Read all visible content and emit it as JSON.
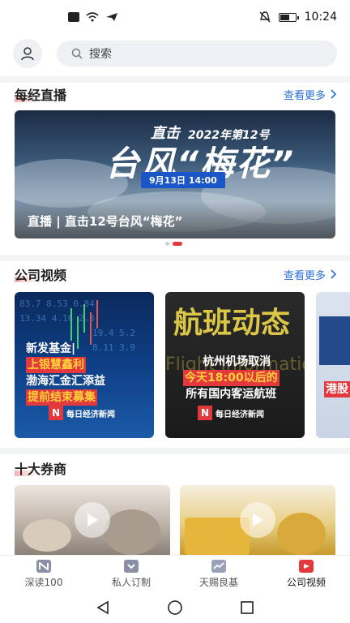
{
  "status_bar": {
    "time": "10:24",
    "battery_level": 0.55
  },
  "search": {
    "placeholder": "搜索"
  },
  "live_section": {
    "title": "每经直播",
    "more_label": "查看更多",
    "banner": {
      "headline_a": "直击",
      "headline_b": "台风“梅花”",
      "sub": "2022年第12号",
      "date": "9月13日 14:00",
      "caption": "直播 | 直击12号台风“梅花”"
    },
    "carousel_active_index": 1,
    "carousel_count": 2
  },
  "video_section": {
    "title": "公司视频",
    "more_label": "查看更多",
    "cards": [
      {
        "lines": [
          "新发基金|",
          "上银慧鑫利",
          "渤海汇金汇添益",
          "提前结束募集"
        ],
        "brand": "每日经济新闻"
      },
      {
        "lines": [
          "杭州机场取消",
          "今天18:00以后的",
          "所有国内客运航班"
        ],
        "brand": "每日经济新闻"
      },
      {
        "lines": [
          "港股"
        ],
        "brand": ""
      }
    ]
  },
  "broker_section": {
    "title": "十大券商"
  },
  "tabs": [
    {
      "label": "深读100",
      "icon": "n-logo-icon",
      "active": false
    },
    {
      "label": "私人订制",
      "icon": "shield-chevron-icon",
      "active": false
    },
    {
      "label": "天赐良基",
      "icon": "chart-line-icon",
      "active": false
    },
    {
      "label": "公司视频",
      "icon": "video-camera-icon",
      "active": true
    }
  ],
  "colors": {
    "accent": "#e4393c",
    "link": "#2a6fd8"
  }
}
